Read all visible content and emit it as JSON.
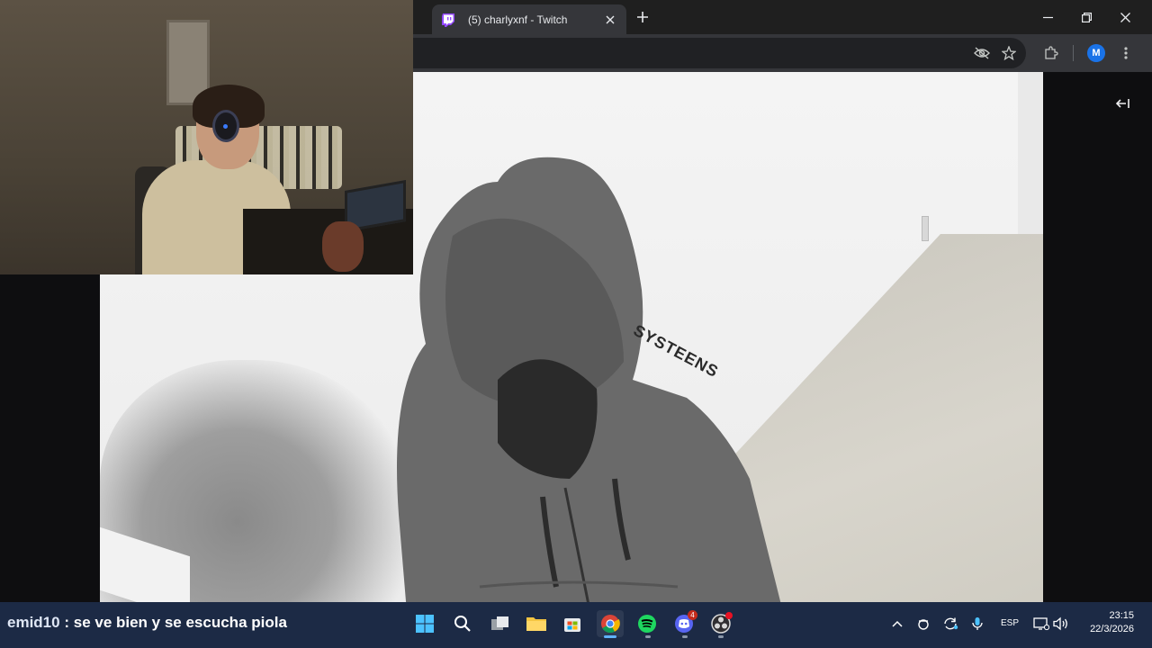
{
  "browser": {
    "tab_title": "(5) charlyxnf - Twitch",
    "profile_initial": "M",
    "accent": "#9146ff"
  },
  "stream": {
    "hoodie_brand_text": "SYSTEENS"
  },
  "chat_overlay": {
    "username": "emid10",
    "separator": ":",
    "message": "se ve bien y se escucha piola"
  },
  "taskbar": {
    "apps": [
      "start-icon",
      "search-icon",
      "task-view-icon",
      "file-explorer-icon",
      "store-icon",
      "chrome-icon",
      "spotify-icon",
      "discord-icon",
      "obs-icon"
    ],
    "discord_badge": "4",
    "language": "ESP",
    "time": "23:15",
    "date": "22/3/2026"
  }
}
